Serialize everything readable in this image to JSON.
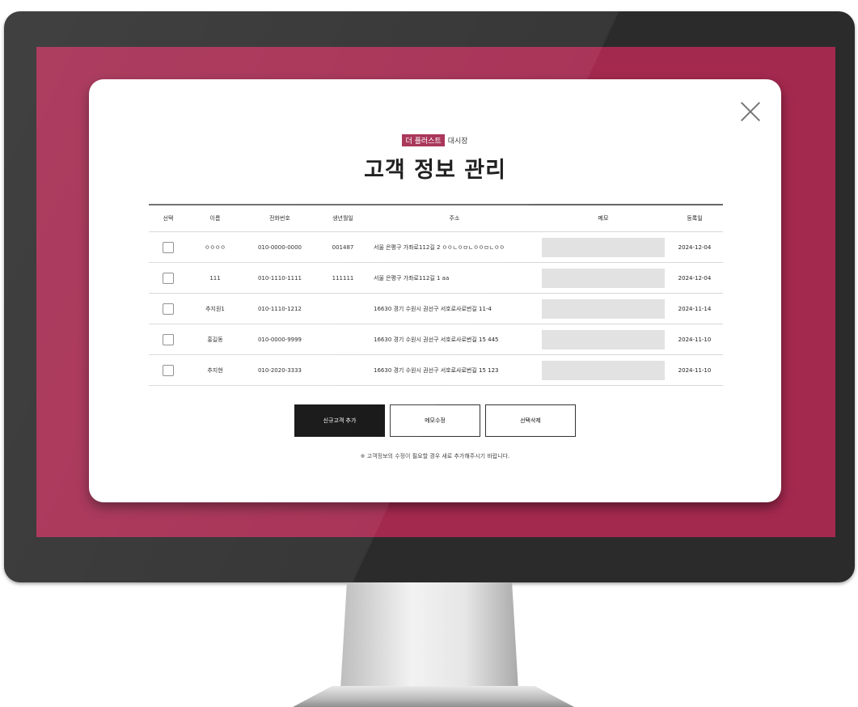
{
  "modal": {
    "brand_badge": "더 플러스트",
    "brand_suffix": "대시장",
    "title": "고객 정보 관리"
  },
  "table": {
    "headers": [
      "선택",
      "이름",
      "전화번호",
      "생년월일",
      "주소",
      "메모",
      "등록일"
    ],
    "rows": [
      {
        "name": "ㅇㅇㅇㅇ",
        "phone": "010-0000-0000",
        "birth": "001487",
        "address": "서울 은평구 가좌로112길 2 ㅇㅇㄴㅇㅁㄴㅇㅇㅁㄴㅇㅇ",
        "memo": "",
        "date": "2024-12-04"
      },
      {
        "name": "111",
        "phone": "010-1110-1111",
        "birth": "111111",
        "address": "서울 은평구 가좌로112길 1 aa",
        "memo": "",
        "date": "2024-12-04"
      },
      {
        "name": "추지원1",
        "phone": "010-1110-1212",
        "birth": "",
        "address": "16630 경기 수원시 권선구 서호로사로번길 11-4",
        "memo": "",
        "date": "2024-11-14"
      },
      {
        "name": "홍길동",
        "phone": "010-0000-9999",
        "birth": "",
        "address": "16630 경기 수원시 권선구 서호로사로번길 15 445",
        "memo": "",
        "date": "2024-11-10"
      },
      {
        "name": "추지현",
        "phone": "010-2020-3333",
        "birth": "",
        "address": "16630 경기 수원시 권선구 서호로사로번길 15 123",
        "memo": "",
        "date": "2024-11-10"
      }
    ]
  },
  "buttons": {
    "add": "신규고객 추가",
    "edit": "메모수정",
    "delete": "선택삭제"
  },
  "notice": "※ 고객정보의 수정이 필요할 경우 새로 추가해주시기 바랍니다.",
  "colors": {
    "screen_bg": "#a4294f",
    "badge_bg": "#a4294f",
    "primary_button": "#0c0c0c"
  },
  "icons": {
    "close": "close-icon"
  }
}
